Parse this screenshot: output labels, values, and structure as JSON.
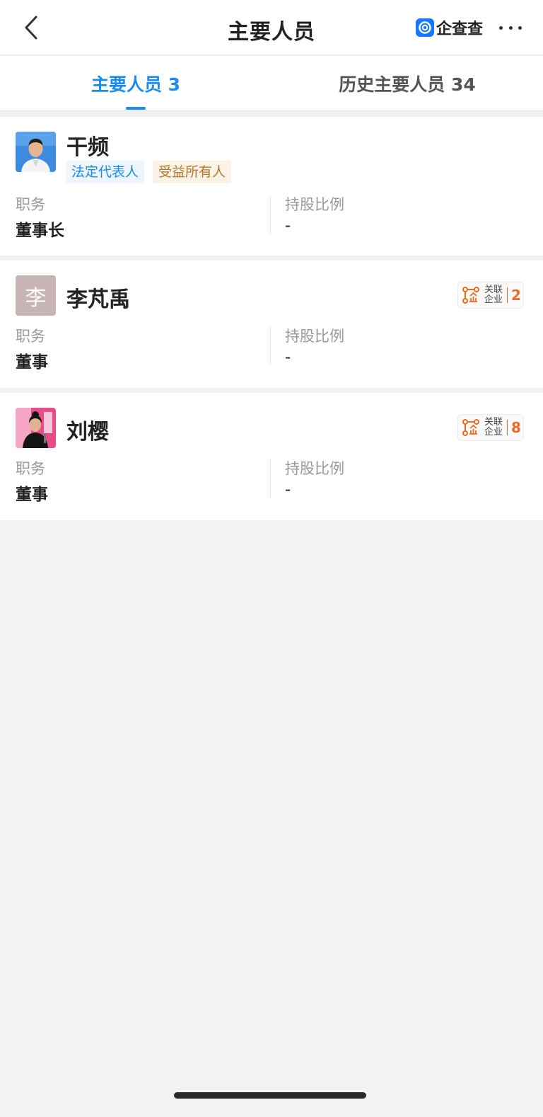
{
  "nav": {
    "title": "主要人员",
    "brand": "企查查",
    "back_icon": "chevron-left-icon",
    "more_icon": "more-horizontal-icon"
  },
  "tabs": [
    {
      "label": "主要人员 3",
      "active": true
    },
    {
      "label": "历史主要人员 34",
      "active": false
    }
  ],
  "colors": {
    "accent": "#1a8cf0",
    "orange": "#f26a22",
    "background": "#f2f2f2"
  },
  "people": [
    {
      "name": "干频",
      "avatar": "photo",
      "tags": [
        "法定代表人",
        "受益所有人"
      ],
      "position_label": "职务",
      "position": "董事长",
      "share_label": "持股比例",
      "share": "-"
    },
    {
      "name": "李芃禹",
      "avatar_text": "李",
      "assoc_label": "关联企业",
      "assoc_count": "2",
      "position_label": "职务",
      "position": "董事",
      "share_label": "持股比例",
      "share": "-"
    },
    {
      "name": "刘樱",
      "avatar": "photo",
      "assoc_label": "关联企业",
      "assoc_count": "8",
      "position_label": "职务",
      "position": "董事",
      "share_label": "持股比例",
      "share": "-"
    }
  ]
}
